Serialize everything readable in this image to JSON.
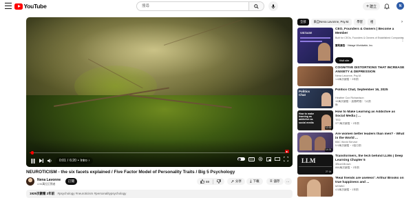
{
  "header": {
    "logo_text": "YouTube",
    "search_placeholder": "搜尋",
    "create_label": "建立",
    "avatar_initials": "N"
  },
  "player": {
    "time_current": "0:01",
    "time_total": "6:20",
    "chapter": "Intro",
    "progress_fraction": 0.003
  },
  "video": {
    "title": "NEUROTICISM - the six facets explained / Five Factor Model of Personality Traits / Big 5 Psychology",
    "channel_name": "Nena Lavonne",
    "subscribers": "4.96萬位訂閱者",
    "subscribe_label": "訂閱",
    "likes": "69",
    "share_label": "分享",
    "download_label": "下載",
    "save_label": "儲存",
    "description_stats": "1929次觀看  2年前",
    "hashtags": "#psychology #neuroticism #personalitypsychology"
  },
  "chips": [
    "全部",
    "來自Nena Lavonne, Psy.M.",
    "學習",
    "相"
  ],
  "ad": {
    "title": "CEO, Founders & Owners | Become a Member",
    "body": "Built for CEOs, Founders & Owners of Established Companies",
    "sponsor_prefix": "贊助廣告",
    "sponsor": "Vistage Worldwide, Inc.",
    "button": "Visit site"
  },
  "recommendations": [
    {
      "title": "COGNITIVE DISTORTIONS THAT INCREASE ANXIETY & DEPRESSION",
      "channel": "Nena Lavonne, Psy.M.",
      "stats": "1.8萬次觀看・3年前",
      "duration": "",
      "thumb": "#7a5236"
    },
    {
      "title": "Politics Chat, September 16, 2025",
      "channel": "Heather Cox Richardson",
      "stats": "10萬次觀看・直播時間：7天前",
      "extra": "新",
      "duration": "",
      "thumb": "#2d3a57"
    },
    {
      "title": "How to Make Learning as Addictive as Social Media | ...",
      "channel": "TED",
      "stats": "377萬次觀看・1年前",
      "duration": "12:32",
      "thumb": "#1e1e1e"
    },
    {
      "title": "Are women better leaders than men? - What in the World ...",
      "channel": "BBC World Service",
      "stats": "5.9萬次觀看・1個月前",
      "duration": "14:31",
      "thumb": "#4e3e6f"
    },
    {
      "title": "Transformers, the tech behind LLMs | Deep Learning Chapter 5",
      "channel": "3Blue1Brown",
      "stats": "868萬次觀看・1年前",
      "duration": "27:14",
      "thumb": "#151515"
    },
    {
      "title": "'Real friends are useless': Arthur Brooks on true happiness and ...",
      "channel": "MSNBC",
      "stats": "4.5萬次觀看・1年前",
      "duration": "",
      "thumb": "#8a5a3c"
    }
  ],
  "colors": {
    "brand_red": "#ff0000",
    "text_primary": "#0f0f0f",
    "text_secondary": "#606060",
    "chip_bg": "#f2f2f2"
  }
}
